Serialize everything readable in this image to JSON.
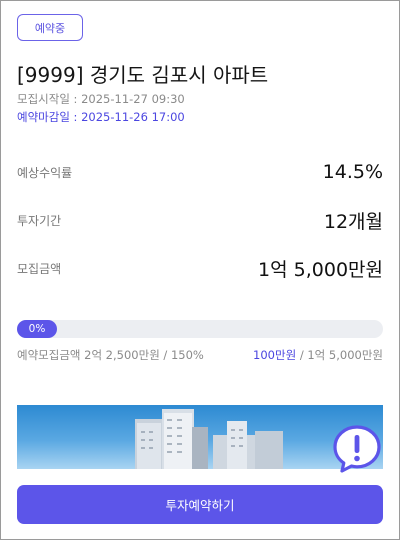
{
  "badge": {
    "label": "예약중"
  },
  "title": "[9999] 경기도 김포시 아파트",
  "recruit_start": "모집시작일 : 2025-11-27 09:30",
  "reservation_deadline": "예약마감일 : 2025-11-26 17:00",
  "stats": [
    {
      "label": "예상수익률",
      "value": "14.5%"
    },
    {
      "label": "투자기간",
      "value": "12개월"
    },
    {
      "label": "모집금액",
      "value": "1억 5,000만원"
    }
  ],
  "progress": {
    "label": "0%",
    "percent": 0,
    "reserved_text": "예약모집금액 2억 2,500만원 / 150%",
    "current_amount": "100만원",
    "total_amount": " / 1억 5,000만원"
  },
  "colors": {
    "accent": "#5c55e9",
    "accent_text": "#4b46e0",
    "sky": "#2d8ad2"
  },
  "notice_icon": "exclamation-bubble-icon",
  "cta": {
    "label": "투자예약하기"
  }
}
